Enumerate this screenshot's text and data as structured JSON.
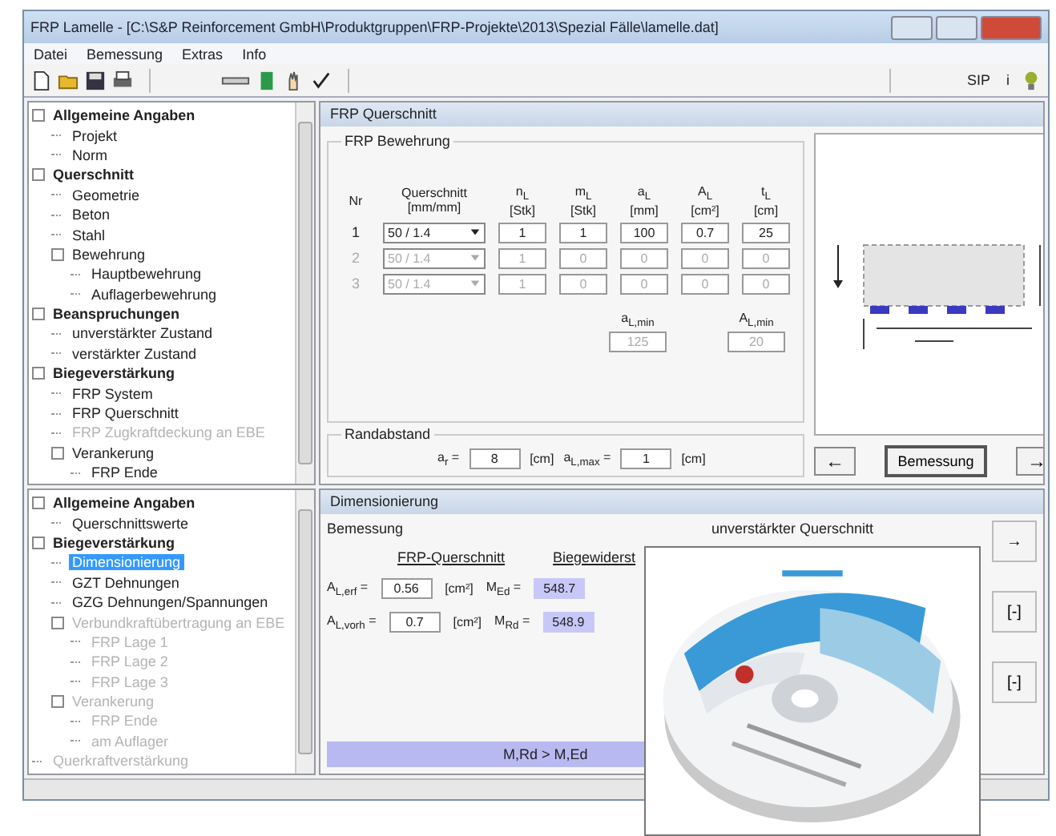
{
  "window": {
    "title": "FRP Lamelle - [C:\\S&P Reinforcement GmbH\\Produktgruppen\\FRP-Projekte\\2013\\Spezial Fälle\\lamelle.dat]"
  },
  "menu": [
    "Datei",
    "Bemessung",
    "Extras",
    "Info"
  ],
  "toolbar": {
    "right": [
      "SIP",
      "i"
    ]
  },
  "tree_top": [
    {
      "label": "Allgemeine Angaben",
      "kind": "group",
      "disabled": false,
      "selected": false,
      "children": [
        {
          "label": "Projekt",
          "kind": "item",
          "disabled": false,
          "selected": false
        },
        {
          "label": "Norm",
          "kind": "item",
          "disabled": false,
          "selected": false
        }
      ]
    },
    {
      "label": "Querschnitt",
      "kind": "group",
      "disabled": false,
      "selected": false,
      "children": [
        {
          "label": "Geometrie",
          "kind": "item",
          "disabled": false,
          "selected": false
        },
        {
          "label": "Beton",
          "kind": "item",
          "disabled": false,
          "selected": false
        },
        {
          "label": "Stahl",
          "kind": "item",
          "disabled": false,
          "selected": false
        },
        {
          "label": "Bewehrung",
          "kind": "item",
          "disabled": false,
          "selected": false,
          "children": [
            {
              "label": "Hauptbewehrung",
              "kind": "item",
              "disabled": false,
              "selected": false
            },
            {
              "label": "Auflagerbewehrung",
              "kind": "item",
              "disabled": false,
              "selected": false
            }
          ]
        }
      ]
    },
    {
      "label": "Beanspruchungen",
      "kind": "group",
      "disabled": false,
      "selected": false,
      "children": [
        {
          "label": "unverstärkter Zustand",
          "kind": "item",
          "disabled": false,
          "selected": false
        },
        {
          "label": "verstärkter Zustand",
          "kind": "item",
          "disabled": false,
          "selected": false
        }
      ]
    },
    {
      "label": "Biegeverstärkung",
      "kind": "group",
      "disabled": false,
      "selected": false,
      "children": [
        {
          "label": "FRP System",
          "kind": "item",
          "disabled": false,
          "selected": false
        },
        {
          "label": "FRP Querschnitt",
          "kind": "item",
          "disabled": false,
          "selected": false
        },
        {
          "label": "FRP Zugkraftdeckung an EBE",
          "kind": "item",
          "disabled": true,
          "selected": false
        },
        {
          "label": "Verankerung",
          "kind": "item",
          "disabled": false,
          "selected": false,
          "children": [
            {
              "label": "FRP Ende",
              "kind": "item",
              "disabled": false,
              "selected": false
            }
          ]
        }
      ]
    }
  ],
  "section_panel": {
    "title": "FRP Querschnitt",
    "group": "FRP Bewehrung",
    "columns": [
      {
        "symbol": "Nr"
      },
      {
        "symbol": "Querschnitt",
        "unit": "[mm/mm]"
      },
      {
        "symbol": "n$_{L}$",
        "unit": "[Stk]"
      },
      {
        "symbol": "m$_{L}$",
        "unit": "[Stk]"
      },
      {
        "symbol": "a$_{L}$",
        "unit": "[mm]"
      },
      {
        "symbol": "A$_{L}$",
        "unit": "[cm²]"
      },
      {
        "symbol": "t$_{L}$",
        "unit": "[cm]"
      }
    ],
    "rows": [
      {
        "nr": "1",
        "profile": "50 / 1.4",
        "values": [
          "1",
          "1",
          "100",
          "0.7",
          "25"
        ],
        "disabled": false
      },
      {
        "nr": "2",
        "profile": "50 / 1.4",
        "values": [
          "1",
          "0",
          "0",
          "0",
          "0"
        ],
        "disabled": true
      },
      {
        "nr": "3",
        "profile": "50 / 1.4",
        "values": [
          "1",
          "0",
          "0",
          "0",
          "0"
        ],
        "disabled": true
      }
    ],
    "min_fields": [
      {
        "symbol": "a$_{L,min}$",
        "value": "125"
      },
      {
        "symbol": "A$_{L,min}$",
        "value": "20"
      }
    ],
    "edge_group": "Randabstand",
    "edge_fields": [
      {
        "symbol": "a$_{r}$ =",
        "value": "8",
        "unit": "[cm]"
      },
      {
        "symbol": "a$_{L,max}$ =",
        "value": "1",
        "unit": "[cm]"
      }
    ],
    "buttons": [
      "←",
      "Bemessung",
      "→"
    ]
  },
  "tree_bottom": [
    {
      "label": "Allgemeine Angaben",
      "kind": "group",
      "disabled": false,
      "selected": false,
      "children": [
        {
          "label": "Querschnittswerte",
          "kind": "item",
          "disabled": false,
          "selected": false
        }
      ]
    },
    {
      "label": "Biegeverstärkung",
      "kind": "group",
      "disabled": false,
      "selected": false,
      "children": [
        {
          "label": "Dimensionierung",
          "kind": "item",
          "disabled": false,
          "selected": true
        },
        {
          "label": "GZT Dehnungen",
          "kind": "item",
          "disabled": false,
          "selected": false
        },
        {
          "label": "GZG Dehnungen/Spannungen",
          "kind": "item",
          "disabled": false,
          "selected": false
        },
        {
          "label": "Verbundkraftübertragung an EBE",
          "kind": "item",
          "disabled": true,
          "selected": false,
          "children": [
            {
              "label": "FRP Lage 1",
              "kind": "item",
              "disabled": true,
              "selected": false
            },
            {
              "label": "FRP Lage 2",
              "kind": "item",
              "disabled": true,
              "selected": false
            },
            {
              "label": "FRP Lage 3",
              "kind": "item",
              "disabled": true,
              "selected": false
            }
          ]
        },
        {
          "label": "Verankerung",
          "kind": "item",
          "disabled": true,
          "selected": false,
          "children": [
            {
              "label": "FRP Ende",
              "kind": "item",
              "disabled": true,
              "selected": false
            },
            {
              "label": "am Auflager",
              "kind": "item",
              "disabled": true,
              "selected": false
            }
          ]
        }
      ]
    },
    {
      "label": "Querkraftverstärkung",
      "kind": "item",
      "disabled": true,
      "selected": false
    }
  ],
  "design_panel": {
    "title": "Dimensionierung",
    "group": "Bemessung",
    "right_label": "unverstärkter Querschnitt",
    "headers": [
      "FRP-Querschnitt",
      "Biegewiderst"
    ],
    "rows": [
      {
        "symbol": "A$_{L,erf}$ =",
        "value": "0.56",
        "unit": "[cm²]",
        "m_symbol": "M$_{Ed}$ =",
        "m_value": "548.7"
      },
      {
        "symbol": "A$_{L,vorh}$ =",
        "value": "0.7",
        "unit": "[cm²]",
        "m_symbol": "M$_{Rd}$ =",
        "m_value": "548.9"
      }
    ],
    "side_buttons": [
      "→",
      "[-]",
      "[-]"
    ],
    "result": "M,Rd  >  M,Ed"
  },
  "overlay": {
    "kind": "picture"
  }
}
